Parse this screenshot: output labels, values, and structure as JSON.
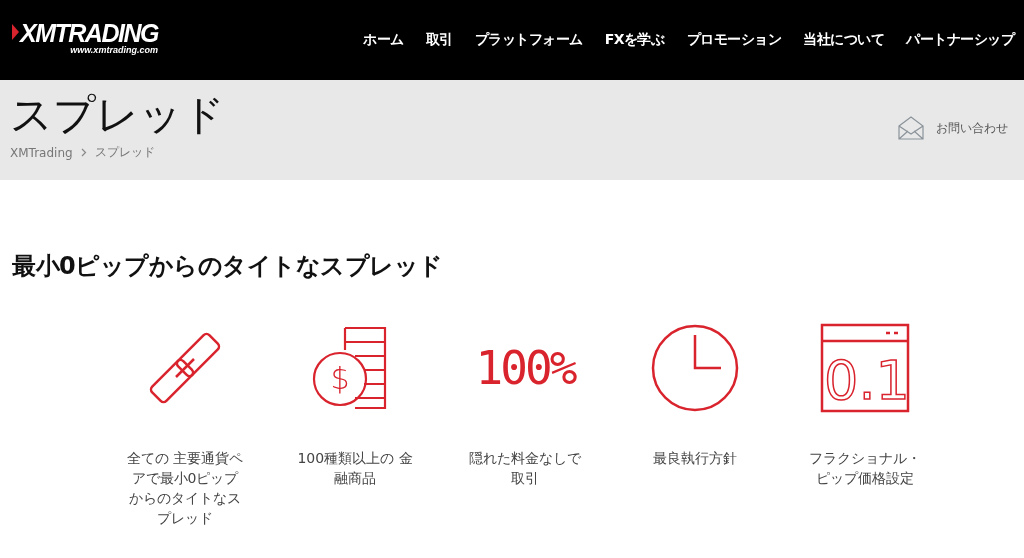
{
  "header": {
    "logo": "XMTRADING",
    "logo_url": "www.xmtrading.com",
    "nav": [
      {
        "label": "ホーム"
      },
      {
        "label": "取引"
      },
      {
        "label": "プラットフォーム"
      },
      {
        "label": "FXを学ぶ"
      },
      {
        "label": "プロモーション"
      },
      {
        "label": "当社について"
      },
      {
        "label": "パートナーシップ"
      }
    ]
  },
  "page_title": "スプレッド",
  "breadcrumb": [
    "XMTrading",
    "スプレッド"
  ],
  "contact": "お問い合わせ",
  "heading": "最小0ピップからのタイトなスプレッド",
  "features": [
    {
      "kind": "link",
      "text": "全ての 主要通貨ペアで最小0ピップからのタイトなスプレッド"
    },
    {
      "kind": "coins",
      "icon_text": "$",
      "text": "100種類以上の 金融商品"
    },
    {
      "kind": "percent",
      "icon_text": "100%",
      "text": "隠れた料金なしで取引"
    },
    {
      "kind": "clock",
      "text": "最良執行方針"
    },
    {
      "kind": "window",
      "icon_text": "0.1",
      "text": "フラクショナル・ピップ価格設定"
    }
  ]
}
